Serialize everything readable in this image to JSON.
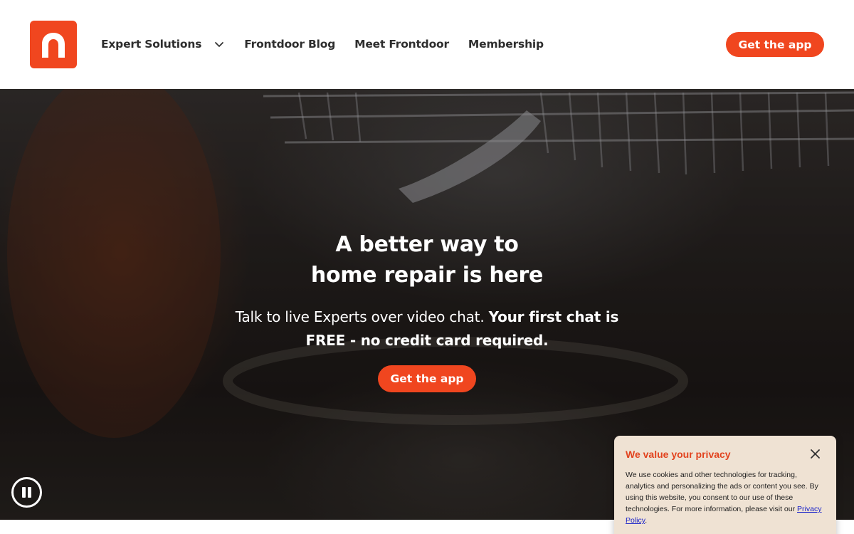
{
  "header": {
    "logo_alt": "Frontdoor",
    "nav": [
      {
        "label": "Expert Solutions"
      },
      {
        "label": "Frontdoor Blog"
      },
      {
        "label": "Meet Frontdoor"
      },
      {
        "label": "Membership"
      }
    ],
    "cta_label": "Get the app"
  },
  "hero": {
    "title_line1": "A better way to",
    "title_line2": "home repair is here",
    "subtitle_regular": "Talk to live Experts over video chat. ",
    "subtitle_bold": "Your first chat is FREE - no credit card required.",
    "cta_label": "Get the app"
  },
  "cookie_banner": {
    "title": "We value your privacy",
    "body": "We use cookies and other technologies for tracking, analytics and personalizing the ads or content you see. By using this website, you consent to our use of these technologies. For more information, please visit our ",
    "link_label": "Privacy Policy",
    "body_end": "."
  },
  "colors": {
    "brand": "#f0461f",
    "cookie_bg": "#efe2d3",
    "cookie_title": "#e2431e",
    "link": "#1a23c9"
  },
  "icons": {
    "logo": "frontdoor-logo-icon",
    "nav_dropdown": "chevron-down-icon",
    "video_control": "pause-icon",
    "cookie_close": "close-icon"
  }
}
